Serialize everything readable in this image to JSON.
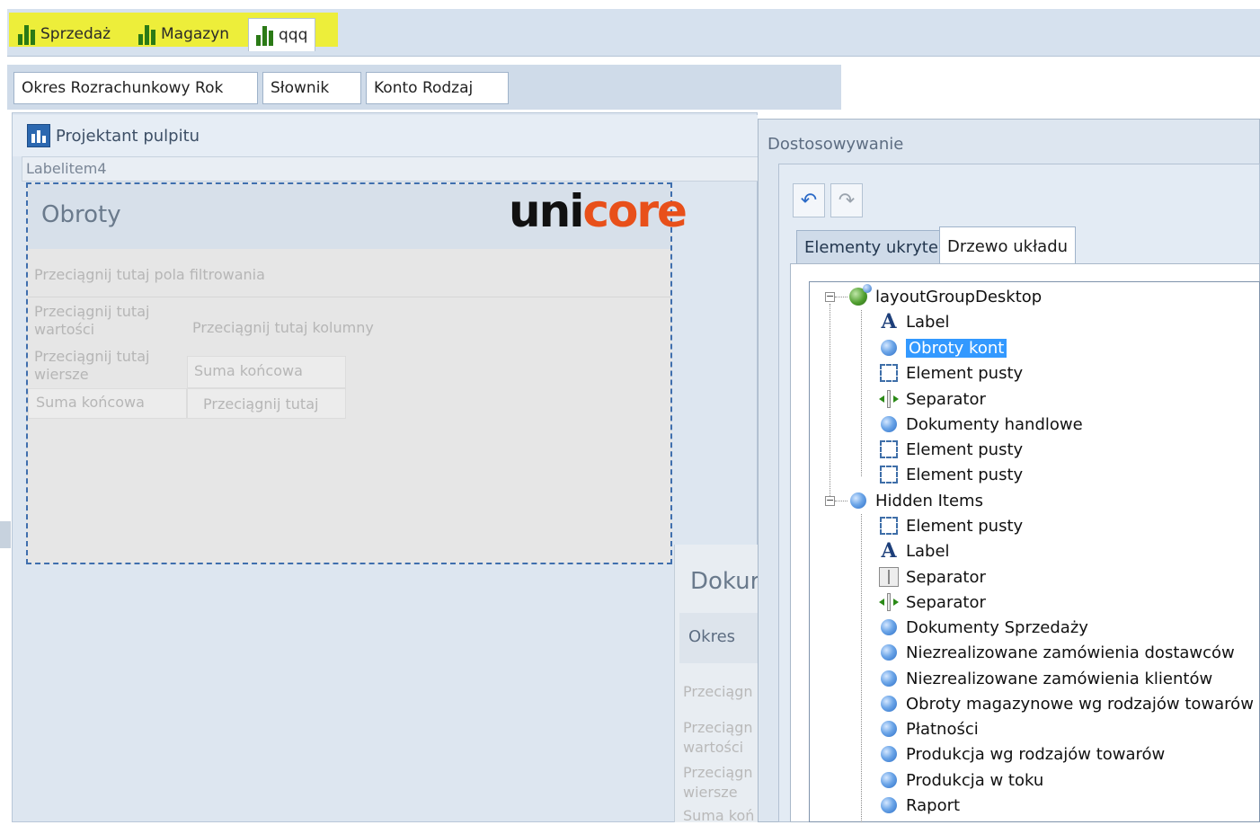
{
  "dashboard_tabs": [
    {
      "label": "Sprzedaż"
    },
    {
      "label": "Magazyn"
    },
    {
      "label": "qqq"
    }
  ],
  "filters": [
    {
      "label": "Okres Rozrachunkowy Rok"
    },
    {
      "label": "Słownik"
    },
    {
      "label": "Konto Rodzaj"
    }
  ],
  "designer": {
    "title": "Projektant pulpitu",
    "label_item": "Labelitem4",
    "pivot": {
      "title": "Obroty",
      "logo_left": "uni",
      "logo_right": "core",
      "filter_area": "Przeciągnij tutaj pola filtrowania",
      "values_area": "Przeciągnij tutaj wartości",
      "columns_area": "Przeciągnij tutaj kolumny",
      "rows_area": "Przeciągnij tutaj wiersze",
      "grand_total_col": "Suma końcowa",
      "grand_total_row": "Suma końcowa",
      "drop_here": "Przeciągnij tutaj"
    },
    "panel2": {
      "title": "Dokur",
      "period": "Okres",
      "drag1": "Przeciągn",
      "drag2": "Przeciągn",
      "values": "wartości",
      "drag3": "Przeciągn",
      "rows": "wiersze",
      "total": "Suma koń"
    }
  },
  "customization": {
    "title": "Dostosowywanie",
    "tabs": [
      {
        "label": "Elementy ukryte"
      },
      {
        "label": "Drzewo układu"
      }
    ],
    "tree": {
      "root": "layoutGroupDesktop",
      "root_children": [
        {
          "label": "Label",
          "icon": "label-icon"
        },
        {
          "label": "Obroty kont",
          "icon": "group-icon",
          "selected": true
        },
        {
          "label": "Element pusty",
          "icon": "empty-element-icon"
        },
        {
          "label": "Separator",
          "icon": "splitter-icon"
        },
        {
          "label": "Dokumenty handlowe",
          "icon": "group-icon"
        },
        {
          "label": "Element pusty",
          "icon": "empty-element-icon"
        },
        {
          "label": "Element pusty",
          "icon": "empty-element-icon"
        }
      ],
      "hidden": "Hidden Items",
      "hidden_children": [
        {
          "label": "Element pusty",
          "icon": "empty-element-icon"
        },
        {
          "label": "Label",
          "icon": "label-icon"
        },
        {
          "label": "Separator",
          "icon": "separator-icon"
        },
        {
          "label": "Separator",
          "icon": "splitter-icon"
        },
        {
          "label": "Dokumenty Sprzedaży",
          "icon": "group-icon"
        },
        {
          "label": "Niezrealizowane zamówienia dostawców",
          "icon": "group-icon"
        },
        {
          "label": "Niezrealizowane zamówienia klientów",
          "icon": "group-icon"
        },
        {
          "label": "Obroty magazynowe wg rodzajów towarów",
          "icon": "group-icon"
        },
        {
          "label": "Płatności",
          "icon": "group-icon"
        },
        {
          "label": "Produkcja wg rodzajów towarów",
          "icon": "group-icon"
        },
        {
          "label": "Produkcja w toku",
          "icon": "group-icon"
        },
        {
          "label": "Raport",
          "icon": "group-icon"
        }
      ]
    }
  },
  "colors": {
    "highlight": "#f1f01a",
    "selection": "#3399ff",
    "brand_orange": "#e8501a",
    "chart_green": "#2b7a16"
  }
}
